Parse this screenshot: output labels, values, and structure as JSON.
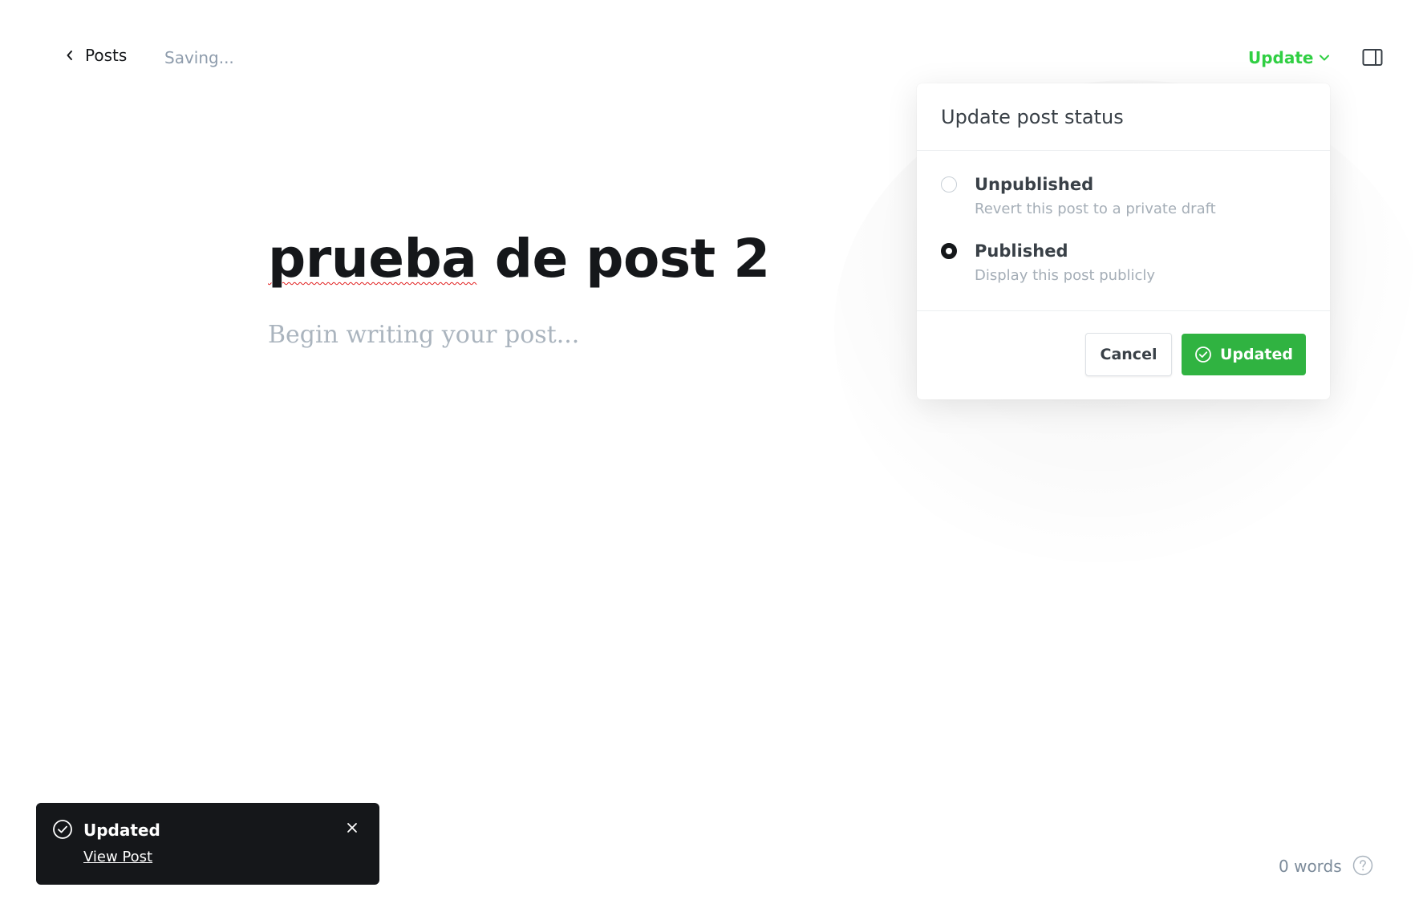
{
  "header": {
    "back_label": "Posts",
    "saving_status": "Saving...",
    "update_label": "Update"
  },
  "editor": {
    "title_word_1": "prueba",
    "title_rest": " de post 2",
    "body_placeholder": "Begin writing your post..."
  },
  "status_popover": {
    "title": "Update post status",
    "options": [
      {
        "label": "Unpublished",
        "description": "Revert this post to a private draft",
        "selected": false
      },
      {
        "label": "Published",
        "description": "Display this post publicly",
        "selected": true
      }
    ],
    "cancel_label": "Cancel",
    "confirm_label": "Updated"
  },
  "toast": {
    "title": "Updated",
    "link_label": "View Post"
  },
  "footer": {
    "word_count": "0 words"
  },
  "colors": {
    "accent_green": "#30cf43",
    "button_green": "#30b341",
    "toast_bg": "#15171a"
  },
  "icons": [
    "chevron-left-icon",
    "chevron-down-icon",
    "sidebar-panel-icon",
    "check-circle-icon",
    "close-icon",
    "help-icon"
  ]
}
